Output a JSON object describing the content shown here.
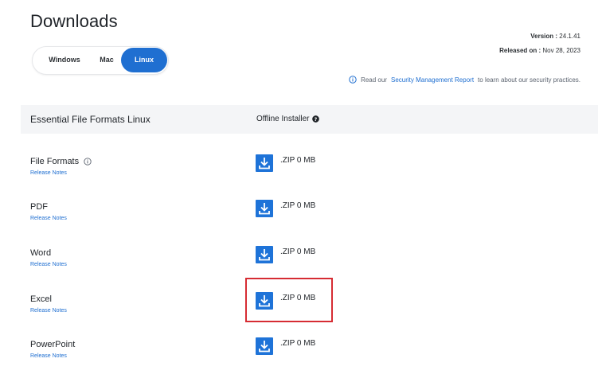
{
  "page": {
    "title": "Downloads"
  },
  "os_tabs": {
    "windows": "Windows",
    "mac": "Mac",
    "linux": "Linux",
    "selected": "Linux"
  },
  "release": {
    "version_label": "Version :",
    "version": "24.1.41",
    "released_label": "Released on :",
    "released": "Nov 28, 2023"
  },
  "security": {
    "prefix": "Read our",
    "link": "Security Management Report",
    "suffix": "to learn about our security practices."
  },
  "table": {
    "col_product": "Essential File Formats Linux",
    "col_installer": "Offline Installer",
    "rows": [
      {
        "name": "File Formats",
        "notes": "Release Notes",
        "size": ".ZIP 0 MB"
      },
      {
        "name": "PDF",
        "notes": "Release Notes",
        "size": ".ZIP 0 MB"
      },
      {
        "name": "Word",
        "notes": "Release Notes",
        "size": ".ZIP 0 MB"
      },
      {
        "name": "Excel",
        "notes": "Release Notes",
        "size": ".ZIP 0 MB"
      },
      {
        "name": "PowerPoint",
        "notes": "Release Notes",
        "size": ".ZIP 0 MB"
      }
    ]
  },
  "colors": {
    "accent": "#1f6fd1",
    "download": "#1e73d8",
    "highlight": "#d62c33"
  },
  "icons": {
    "info": "info-circle-icon",
    "help": "question-circle-icon",
    "download": "download-icon"
  }
}
